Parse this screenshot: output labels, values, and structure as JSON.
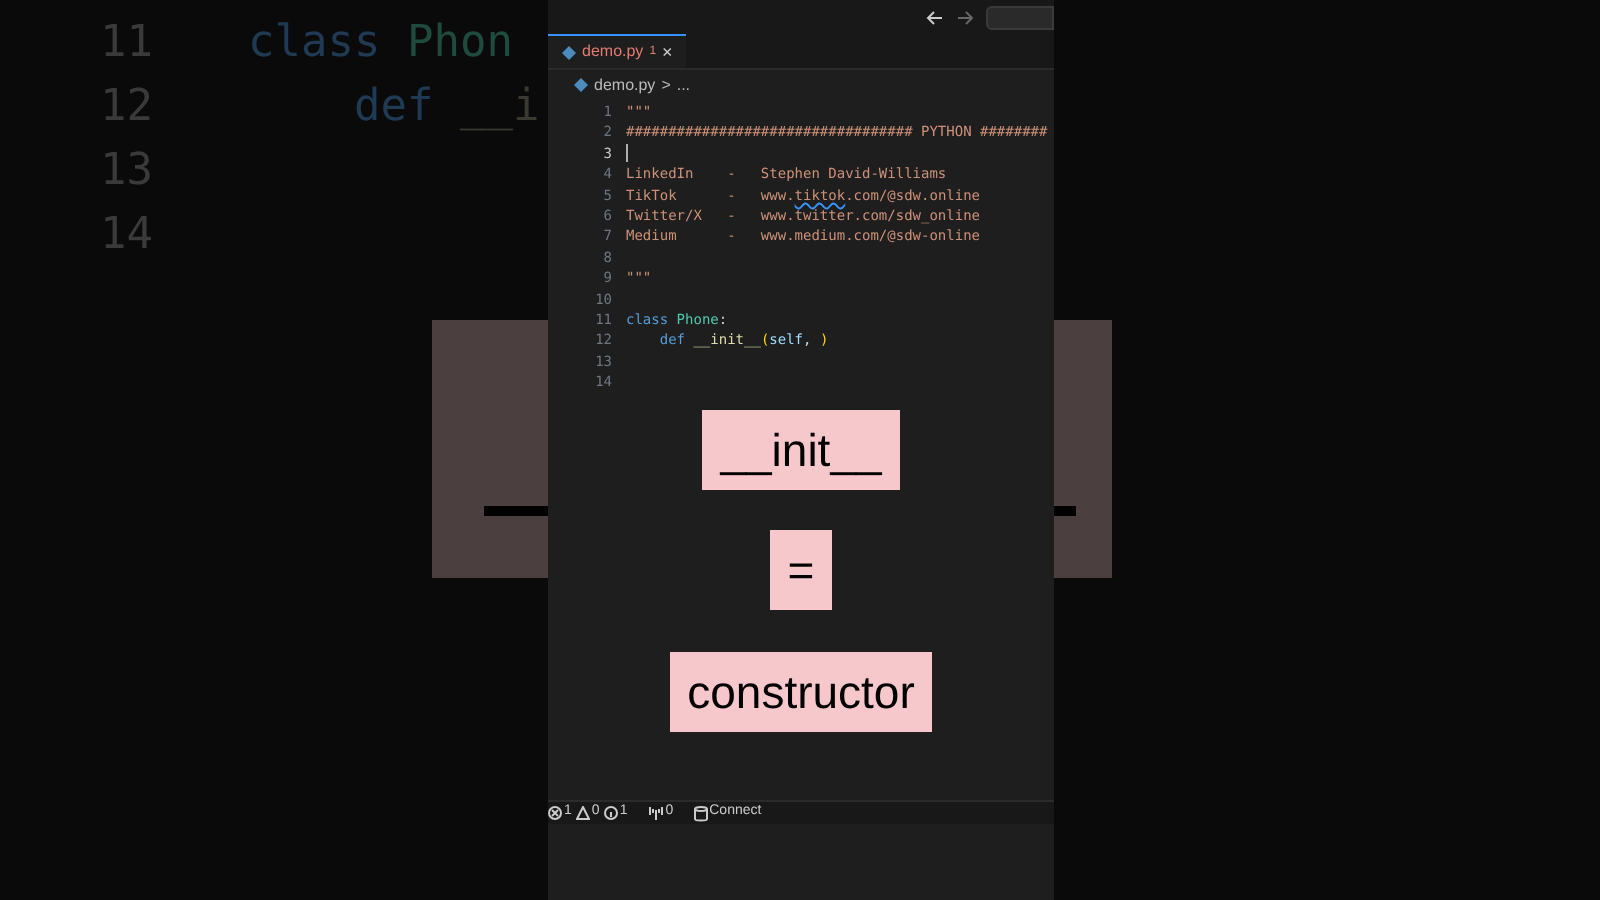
{
  "background": {
    "lines": [
      {
        "number": "11",
        "tokens": [
          {
            "text": "class ",
            "kind": "keyword"
          },
          {
            "text": "Phon",
            "kind": "class"
          }
        ]
      },
      {
        "number": "12",
        "tokens": [
          {
            "text": "    def ",
            "kind": "keyword"
          },
          {
            "text": "__i",
            "kind": "function"
          }
        ]
      },
      {
        "number": "13"
      },
      {
        "number": "14"
      }
    ]
  },
  "editor": {
    "tab": {
      "label": "demo.py",
      "badge": "1",
      "close": "×",
      "selected": true
    },
    "breadcrumb": {
      "file": "demo.py",
      "separator": ">",
      "rest": "..."
    },
    "lines": [
      {
        "number": "1",
        "active": false,
        "tokens": [
          {
            "text": "\"\"\"",
            "kind": "string"
          }
        ]
      },
      {
        "number": "2",
        "active": false,
        "tokens": [
          {
            "text": "################################## PYTHON ########",
            "kind": "string"
          }
        ]
      },
      {
        "number": "3",
        "active": true
      },
      {
        "number": "4",
        "active": false,
        "tokens": [
          {
            "text": "LinkedIn    -   Stephen David-Williams",
            "kind": "string"
          }
        ]
      },
      {
        "number": "5",
        "active": false,
        "tokens": [
          {
            "text": "TikTok      -   www.",
            "kind": "string"
          },
          {
            "text": "tiktok",
            "kind": "string",
            "squiggle": true
          },
          {
            "text": ".com/@sdw.online",
            "kind": "string"
          }
        ]
      },
      {
        "number": "6",
        "active": false,
        "tokens": [
          {
            "text": "Twitter/X   -   www.twitter.com/sdw_online",
            "kind": "string"
          }
        ]
      },
      {
        "number": "7",
        "active": false,
        "tokens": [
          {
            "text": "Medium      -   www.medium.com/@sdw-online",
            "kind": "string"
          }
        ]
      },
      {
        "number": "8",
        "active": false
      },
      {
        "number": "9",
        "active": false,
        "tokens": [
          {
            "text": "\"\"\"",
            "kind": "string"
          }
        ]
      },
      {
        "number": "10",
        "active": false
      },
      {
        "number": "11",
        "active": false,
        "tokens": [
          {
            "text": "class ",
            "kind": "keyword"
          },
          {
            "text": "Phone",
            "kind": "class"
          },
          {
            "text": ":",
            "kind": "plain"
          }
        ]
      },
      {
        "number": "12",
        "active": false,
        "tokens": [
          {
            "text": "    def ",
            "kind": "keyword"
          },
          {
            "text": "__init__",
            "kind": "function"
          },
          {
            "text": "(",
            "kind": "bracket"
          },
          {
            "text": "self",
            "kind": "param"
          },
          {
            "text": ", ",
            "kind": "plain"
          },
          {
            "text": ")",
            "kind": "bracket"
          }
        ]
      },
      {
        "number": "13",
        "active": false
      },
      {
        "number": "14",
        "active": false
      }
    ]
  },
  "overlay_labels": [
    "__init__",
    "=",
    "constructor"
  ],
  "status_bar": {
    "errors": "1",
    "warnings": "0",
    "info": "1",
    "ports": "0",
    "connect": "Connect"
  }
}
